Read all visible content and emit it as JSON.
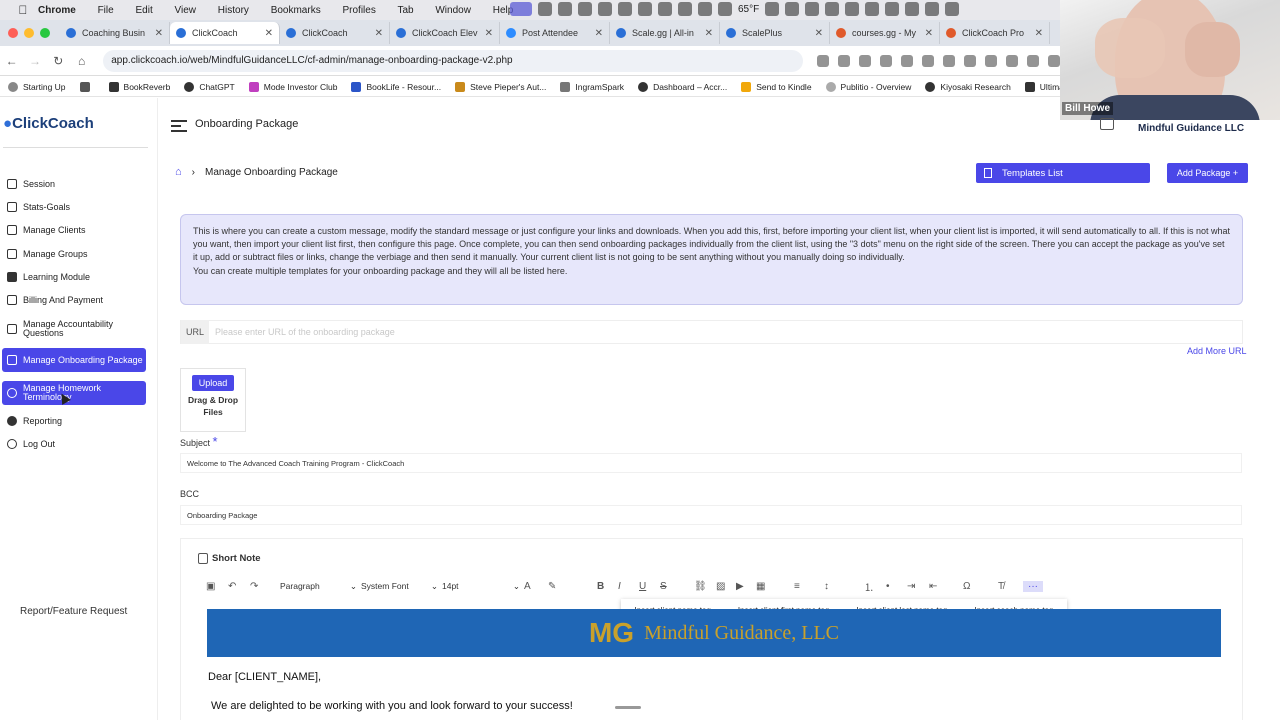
{
  "mac_menu": {
    "apple": "",
    "app": "Chrome",
    "items": [
      "File",
      "Edit",
      "View",
      "History",
      "Bookmarks",
      "Profiles",
      "Tab",
      "Window",
      "Help"
    ],
    "weather": "65°F"
  },
  "tabs": [
    {
      "title": "Coaching Busin"
    },
    {
      "title": "ClickCoach",
      "active": true
    },
    {
      "title": "ClickCoach"
    },
    {
      "title": "ClickCoach Elev"
    },
    {
      "title": "Post Attendee"
    },
    {
      "title": "Scale.gg | All-in"
    },
    {
      "title": "ScalePlus"
    },
    {
      "title": "courses.gg - My"
    },
    {
      "title": "ClickCoach Pro"
    }
  ],
  "address": {
    "url": "app.clickcoach.io/web/MindfulGuidanceLLC/cf-admin/manage-onboarding-package-v2.php"
  },
  "bookmarks": [
    "Starting Up",
    "BookReverb",
    "ChatGPT",
    "Mode Investor Club",
    "BookLife - Resour...",
    "Steve Pieper's Aut...",
    "IngramSpark",
    "Dashboard – Accr...",
    "Send to Kindle",
    "Publitio - Overview",
    "Kiyosaki Research",
    "Ultimate Trip Pla"
  ],
  "webcam": {
    "name": "Bill Howe"
  },
  "sidebar": {
    "logo": "ClickCoach",
    "items": [
      {
        "label": "Session"
      },
      {
        "label": "Stats-Goals"
      },
      {
        "label": "Manage Clients"
      },
      {
        "label": "Manage Groups"
      },
      {
        "label": "Learning Module"
      },
      {
        "label": "Billing And Payment"
      },
      {
        "label": "Manage Accountability Questions"
      },
      {
        "label": "Manage Onboarding Package",
        "active": true
      },
      {
        "label": "Manage Homework Terminology",
        "active": true
      },
      {
        "label": "Reporting"
      },
      {
        "label": "Log Out"
      }
    ],
    "feature_request": "Report/Feature Request"
  },
  "header": {
    "title": "Onboarding Package",
    "org": "Mindful Guidance LLC"
  },
  "breadcrumb": {
    "current": "Manage Onboarding Package"
  },
  "buttons": {
    "templates": "Templates List",
    "add_package": "Add Package +"
  },
  "info": {
    "p1": "This is where you can create a custom message, modify the standard message or just configure your links and downloads. When you add this, first, before importing your client list, when your client list is imported, it will send automatically to all. If this is not what you want, then import your client list first, then configure this page. Once complete, you can then send onboarding packages individually from the client list, using the \"3 dots\" menu on the right side of the screen. There you can accept the package as you've set it up, add or subtract files or links, change the verbiage and then send it manually. Your current client list is not going to be sent anything without you manually doing so individually.",
    "p2": "You can create multiple templates for your onboarding package and they will all be listed here."
  },
  "url_field": {
    "label": "URL",
    "placeholder": "Please enter URL of the onboarding package",
    "add_more": "Add More URL"
  },
  "upload": {
    "button": "Upload",
    "drop": "Drag & Drop Files"
  },
  "subject": {
    "label": "Subject",
    "required": "*",
    "value": "Welcome to The Advanced Coach Training Program - ClickCoach"
  },
  "bcc": {
    "label": "BCC",
    "value": "Onboarding Package"
  },
  "editor": {
    "title": "Short Note",
    "block": "Paragraph",
    "font": "System Font",
    "size": "14pt",
    "tags": [
      "Insert client name tag",
      "Insert client first name tag",
      "Insert client last name tag",
      "Insert coach name tag"
    ],
    "banner_text": "Mindful Guidance, LLC",
    "greeting": "Dear [CLIENT_NAME],",
    "line1": "We are delighted to be working with you and look forward to your success!"
  },
  "colors": {
    "accent": "#4a47e8",
    "banner": "#1f66b5",
    "gold": "#c9a12b"
  }
}
